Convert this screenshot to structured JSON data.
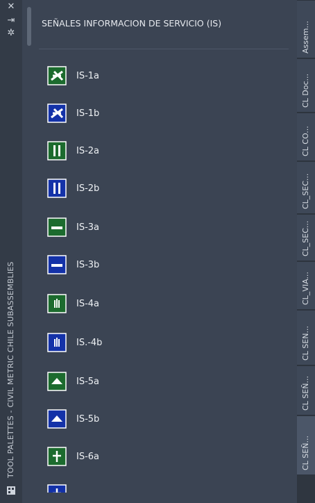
{
  "window": {
    "title": "TOOL PALETTES - CIVIL METRIC CHILE SUBASSEMBLIES"
  },
  "palette": {
    "title": "SEÑALES INFORMACION DE SERVICIO (IS)",
    "items": [
      {
        "label": "IS-1a",
        "icon": "airplane-sign-icon",
        "color": "#1c6b2e"
      },
      {
        "label": "IS-1b",
        "icon": "airplane-sign-icon",
        "color": "#1432a8"
      },
      {
        "label": "IS-2a",
        "icon": "fork-knife-sign-icon",
        "color": "#1c6b2e"
      },
      {
        "label": "IS-2b",
        "icon": "fork-knife-sign-icon",
        "color": "#1432a8"
      },
      {
        "label": "IS-3a",
        "icon": "bed-sign-icon",
        "color": "#1c6b2e"
      },
      {
        "label": "IS-3b",
        "icon": "bed-sign-icon",
        "color": "#1432a8"
      },
      {
        "label": "IS-4a",
        "icon": "hand-sign-icon",
        "color": "#1c6b2e"
      },
      {
        "label": "IS.-4b",
        "icon": "hand-sign-icon",
        "color": "#1432a8"
      },
      {
        "label": "IS-5a",
        "icon": "tent-sign-icon",
        "color": "#1c6b2e"
      },
      {
        "label": "IS-5b",
        "icon": "tent-sign-icon",
        "color": "#1432a8"
      },
      {
        "label": "IS-6a",
        "icon": "cross-sign-icon",
        "color": "#1c6b2e"
      }
    ]
  },
  "tabs": [
    {
      "label": "Assem..."
    },
    {
      "label": "CL Doc..."
    },
    {
      "label": "CL CO..."
    },
    {
      "label": "CL_SEC..."
    },
    {
      "label": "CL_SEC..."
    },
    {
      "label": "CL_VIA..."
    },
    {
      "label": "CL SEN..."
    },
    {
      "label": "CL SEÑ..."
    },
    {
      "label": "CL SEÑ..."
    }
  ]
}
